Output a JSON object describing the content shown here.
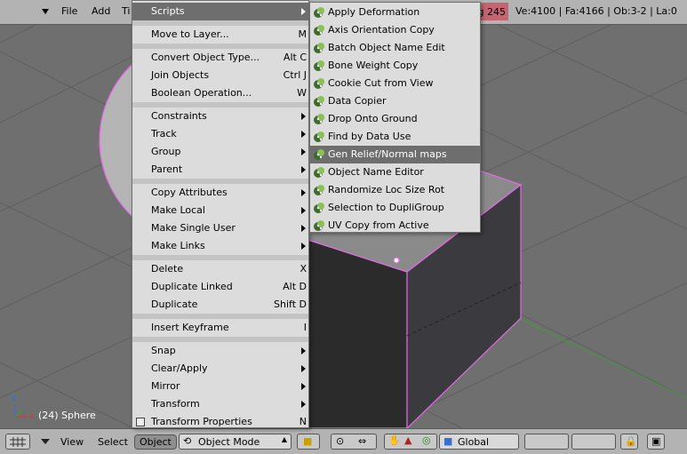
{
  "header": {
    "menus": [
      "File",
      "Add",
      "Ti"
    ],
    "stats_highlight": "g 245",
    "stats": "Ve:4100 | Fa:4166 | Ob:3-2 | La:0"
  },
  "object_menu": {
    "items": [
      {
        "label": "Scripts",
        "shortcut": "",
        "submenu": true,
        "highlight": true
      },
      {
        "sep": true
      },
      {
        "label": "Move to Layer...",
        "shortcut": "M"
      },
      {
        "sep": true
      },
      {
        "label": "Convert Object Type...",
        "shortcut": "Alt C"
      },
      {
        "label": "Join Objects",
        "shortcut": "Ctrl J"
      },
      {
        "label": "Boolean Operation...",
        "shortcut": "W"
      },
      {
        "sep": true
      },
      {
        "label": "Constraints",
        "submenu": true
      },
      {
        "label": "Track",
        "submenu": true
      },
      {
        "label": "Group",
        "submenu": true
      },
      {
        "label": "Parent",
        "submenu": true
      },
      {
        "sep": true
      },
      {
        "label": "Copy Attributes",
        "submenu": true
      },
      {
        "label": "Make Local",
        "submenu": true
      },
      {
        "label": "Make Single User",
        "submenu": true
      },
      {
        "label": "Make Links",
        "submenu": true
      },
      {
        "sep": true
      },
      {
        "label": "Delete",
        "shortcut": "X"
      },
      {
        "label": "Duplicate Linked",
        "shortcut": "Alt D"
      },
      {
        "label": "Duplicate",
        "shortcut": "Shift D"
      },
      {
        "sep": true
      },
      {
        "label": "Insert Keyframe",
        "shortcut": "I"
      },
      {
        "sep": true
      },
      {
        "label": "Snap",
        "submenu": true
      },
      {
        "label": "Clear/Apply",
        "submenu": true
      },
      {
        "label": "Mirror",
        "submenu": true
      },
      {
        "label": "Transform",
        "submenu": true
      },
      {
        "label": "Transform Properties",
        "shortcut": "N",
        "checkbox": true
      }
    ]
  },
  "scripts_menu": {
    "icon": "python-icon",
    "items": [
      {
        "label": "Apply Deformation"
      },
      {
        "label": "Axis Orientation Copy"
      },
      {
        "label": "Batch Object Name Edit"
      },
      {
        "label": "Bone Weight Copy"
      },
      {
        "label": "Cookie Cut from View"
      },
      {
        "label": "Data Copier"
      },
      {
        "label": "Drop Onto Ground"
      },
      {
        "label": "Find by Data Use"
      },
      {
        "label": "Gen Relief/Normal maps",
        "highlight": true
      },
      {
        "label": "Object Name Editor"
      },
      {
        "label": "Randomize Loc Size Rot"
      },
      {
        "label": "Selection to DupliGroup"
      },
      {
        "label": "UV Copy from Active"
      }
    ]
  },
  "viewport": {
    "object_label": "(24) Sphere",
    "axis_x": "x",
    "axis_z": "z"
  },
  "footer": {
    "view": "View",
    "select": "Select",
    "object": "Object",
    "mode": "Object Mode",
    "orientation": "Global"
  },
  "colors": {
    "menu_bg": "#dcdcdc",
    "highlight": "#6e6e6e",
    "header_bg": "#b3b3b3",
    "viewport_bg": "#6f6f6f",
    "selection": "#e36be3",
    "stats_red": "#c46571"
  }
}
